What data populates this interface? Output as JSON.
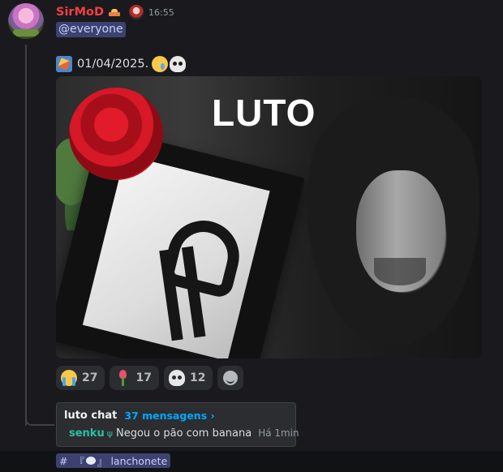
{
  "message": {
    "author": "SirMoD",
    "timestamp": "16:55",
    "mention": "@everyone",
    "content_text": "01/04/2025.",
    "content_icons": [
      "rocket-icon",
      "crying-face-icon",
      "skull-icon"
    ],
    "colors": {
      "author": "#f23f42",
      "mention_bg": "#3c4270",
      "link": "#00a8fc"
    }
  },
  "image": {
    "overlay_text": "LUTO"
  },
  "reactions": [
    {
      "icon": "sob-icon",
      "count": "27"
    },
    {
      "icon": "tulip-icon",
      "count": "17"
    },
    {
      "icon": "skull-icon",
      "count": "12"
    }
  ],
  "thread": {
    "name": "luto chat",
    "count": "37 mensagens ›",
    "last_author": "senku",
    "last_author_badge": "ψ",
    "last_message": "Negou o pão com banana",
    "last_time": "Há 1min"
  },
  "bottom": {
    "hash": "#",
    "channel_left": "『",
    "channel_right": "』",
    "channel_name": "lanchonete"
  }
}
